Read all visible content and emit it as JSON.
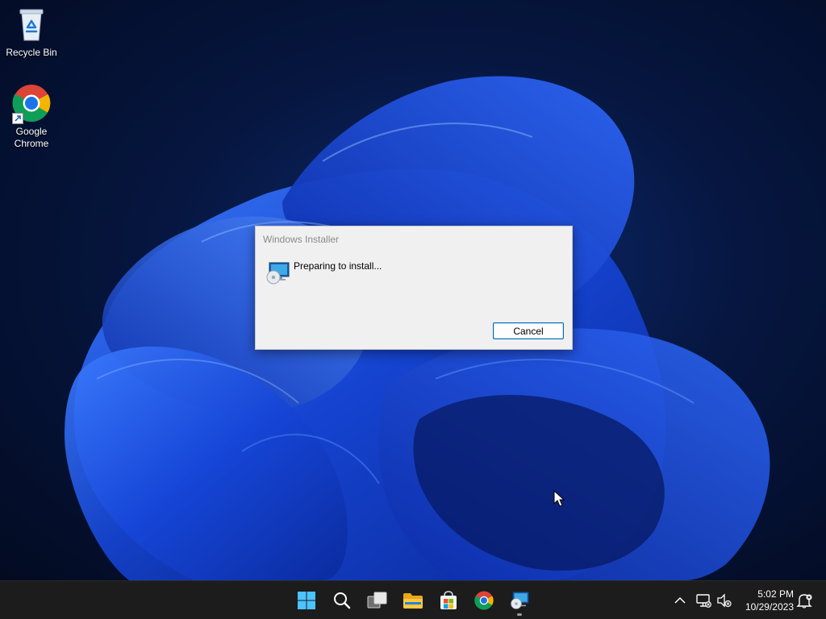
{
  "desktop": {
    "icons": [
      {
        "label": "Recycle Bin",
        "icon": "recycle-bin-icon"
      },
      {
        "label": "Google Chrome",
        "icon": "chrome-icon"
      }
    ]
  },
  "dialog": {
    "title": "Windows Installer",
    "icon": "installer-icon",
    "message": "Preparing to install...",
    "cancel_label": "Cancel"
  },
  "taskbar": {
    "pinned": [
      {
        "name": "start",
        "icon": "windows-logo-icon"
      },
      {
        "name": "search",
        "icon": "search-icon"
      },
      {
        "name": "task-view",
        "icon": "task-view-icon"
      },
      {
        "name": "file-explorer",
        "icon": "folder-icon"
      },
      {
        "name": "microsoft-store",
        "icon": "store-icon"
      },
      {
        "name": "chrome",
        "icon": "chrome-icon"
      },
      {
        "name": "windows-installer",
        "icon": "installer-icon",
        "active": true
      }
    ],
    "tray": {
      "icons": [
        "chevron-up-icon",
        "network-icon",
        "volume-muted-icon",
        "notification-icon"
      ],
      "time": "5:02 PM",
      "date": "10/29/2023"
    }
  },
  "colors": {
    "accent": "#0067c0",
    "wallpaper_dark": "#030b22",
    "wallpaper_blue": "#1a4fe0",
    "taskbar": "#1c1c1c",
    "dialog": "#f0f0f0"
  }
}
